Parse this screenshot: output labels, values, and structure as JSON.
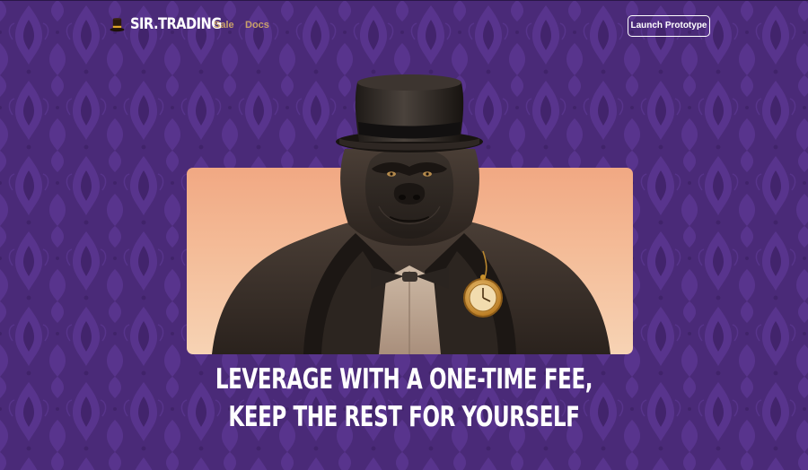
{
  "nav": {
    "brand_name": "SIR.TRADING",
    "brand_icon": "top-hat-icon",
    "links": [
      {
        "label": "Sale"
      },
      {
        "label": "Docs"
      }
    ],
    "cta_label": "Launch Prototype"
  },
  "hero": {
    "image": "gorilla-in-top-hat-illustration",
    "headline_line1": "LEVERAGE WITH A ONE-TIME FEE,",
    "headline_line2": "KEEP THE REST FOR YOURSELF"
  },
  "colors": {
    "background": "#4a2a78",
    "pattern": "#5b3790",
    "nav_link": "#c9a16a",
    "hero_card_top": "#f1a883",
    "hero_card_bottom": "#f7d3b4",
    "text": "#ffffff"
  }
}
